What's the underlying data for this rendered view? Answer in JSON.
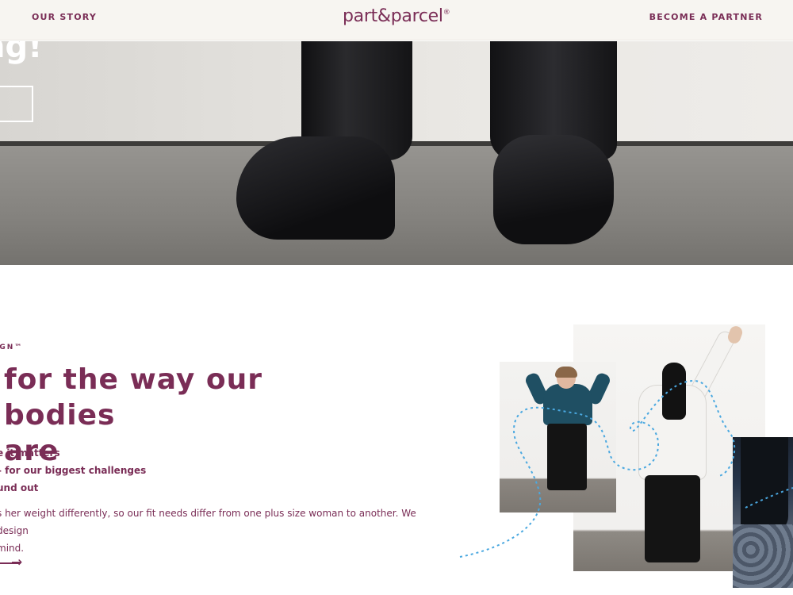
{
  "header": {
    "left_link": "OUR STORY",
    "logo_text": "part&parcel",
    "logo_mark": "®",
    "right_link": "BECOME A PARTNER"
  },
  "hero": {
    "heading_fragment": "ng!",
    "image": "boots-on-concrete-floor"
  },
  "section": {
    "eyebrow": "IGN™",
    "title_line1": "for the way our bodies",
    "title_line2": "are",
    "bullets": [
      "e it matters",
      "– for our biggest challenges",
      "und out"
    ],
    "body_line1": "s her weight differently, so our fit needs differ from one plus size woman to another. We design",
    "body_line2": "mind.",
    "arrow_icon": "arrow-right-icon"
  },
  "colors": {
    "brand": "#7a2d56",
    "header_bg": "#f7f5f1",
    "dash_line": "#4aa8e0"
  }
}
